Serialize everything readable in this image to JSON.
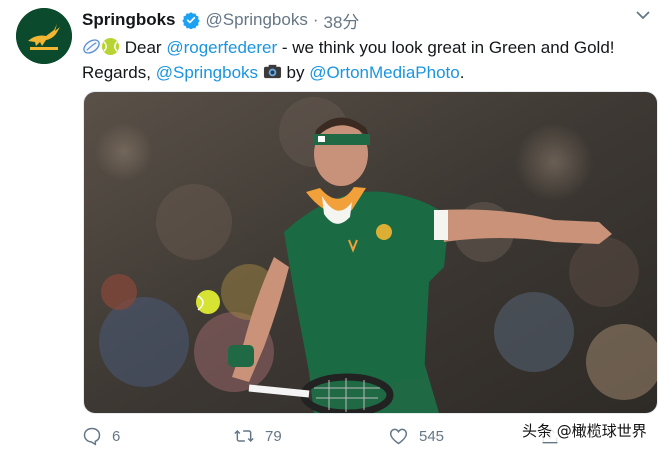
{
  "tweet": {
    "display_name": "Springboks",
    "handle": "@Springboks",
    "separator": "·",
    "time": "38分",
    "text": {
      "dear": "Dear",
      "mention_federer": "@rogerfederer",
      "body": "- we think you look great in Green and Gold!",
      "regards": "Regards,",
      "mention_springboks": "@Springboks",
      "by": "by",
      "mention_photo": "@OrtonMediaPhoto",
      "end": "."
    }
  },
  "actions": {
    "replies": "6",
    "retweets": "79",
    "likes": "545"
  },
  "watermark": "头条 @橄榄球世界",
  "colors": {
    "brand_green": "#0b4a2c",
    "brand_gold": "#f2b632",
    "link": "#1b95e0",
    "muted": "#657786"
  },
  "icons": [
    "springbok-logo",
    "verified-badge-icon",
    "chevron-down-icon",
    "rugby-ball-emoji",
    "tennis-ball-emoji",
    "camera-emoji",
    "reply-icon",
    "retweet-icon",
    "like-icon",
    "share-icon"
  ]
}
